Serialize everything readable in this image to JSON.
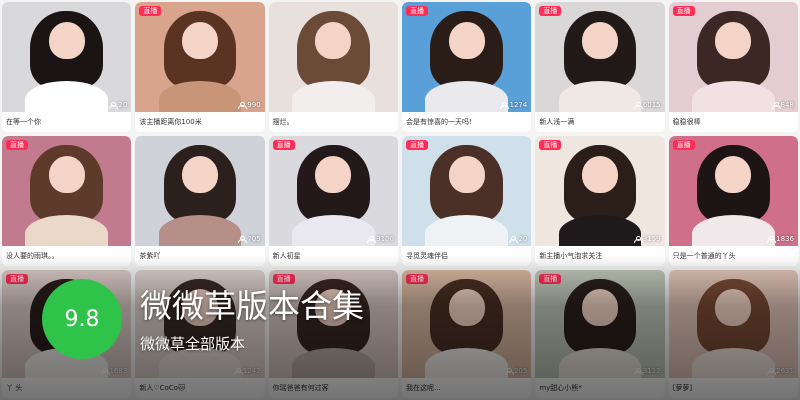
{
  "banner": {
    "score": "9.8",
    "app_name": "微微草版本合集",
    "app_subtitle": "微微草全部版本"
  },
  "live_badge": "直播",
  "streams": [
    {
      "title": "在等一个你",
      "viewers": "20",
      "live": false,
      "bg": "#d9d9dc",
      "hair": "#1b1414",
      "top": "#ffffff"
    },
    {
      "title": "该主播距离你100米",
      "viewers": "990",
      "live": true,
      "bg": "#d8a58c",
      "hair": "#5a3323",
      "top": "#c99579"
    },
    {
      "title": "摆烂。",
      "viewers": "",
      "live": false,
      "bg": "#e7e0dc",
      "hair": "#6b4a38",
      "top": "#f2eeee"
    },
    {
      "title": "会是有惊喜的一天吗!",
      "viewers": "1274",
      "live": true,
      "bg": "#5aa0d8",
      "hair": "#2a1d18",
      "top": "#e9e9ee"
    },
    {
      "title": "新人浅一满",
      "viewers": "6015",
      "live": true,
      "bg": "#d9d7d8",
      "hair": "#221a18",
      "top": "#efe8e4"
    },
    {
      "title": "稳稳很棒",
      "viewers": "848",
      "live": true,
      "bg": "#e3ccd2",
      "hair": "#3b2723",
      "top": "#f2e1e4"
    },
    {
      "title": "没人要的雨琪。。",
      "viewers": "",
      "live": true,
      "bg": "#c27b8e",
      "hair": "#5e3a2a",
      "top": "#ead8c9"
    },
    {
      "title": "茶紫吖",
      "viewers": "705",
      "live": false,
      "bg": "#cfd2d8",
      "hair": "#2c201d",
      "top": "#b58f88"
    },
    {
      "title": "新人初星",
      "viewers": "3100",
      "live": true,
      "bg": "#d9d9de",
      "hair": "#23191b",
      "top": "#e8e8ee"
    },
    {
      "title": "寻觅灵魂伴侣",
      "viewers": "20",
      "live": true,
      "bg": "#cfe0ea",
      "hair": "#4a3026",
      "top": "#eef2f4"
    },
    {
      "title": "新主播小气泡求关注",
      "viewers": "3159",
      "live": true,
      "bg": "#efe6df",
      "hair": "#2b1d18",
      "top": "#1f1a1b"
    },
    {
      "title": "只是一个普通的丫头",
      "viewers": "1836",
      "live": true,
      "bg": "#cf6f8a",
      "hair": "#1d1416",
      "top": "#f0e8ea"
    },
    {
      "title": "丫 头",
      "viewers": "1683",
      "live": true,
      "bg": "#d9c9c4",
      "hair": "#2a1e1a",
      "top": "#f2efee"
    },
    {
      "title": "新人♡CoCo🐱",
      "viewers": "1242",
      "live": false,
      "bg": "#ddd1cc",
      "hair": "#3a2a24",
      "top": "#e7dfdc"
    },
    {
      "title": "你瑶爸爸有何过客",
      "viewers": "",
      "live": true,
      "bg": "#d7c7c2",
      "hair": "#3a2721",
      "top": "#b8aba6"
    },
    {
      "title": "我在这呢...",
      "viewers": "205",
      "live": true,
      "bg": "#d9b8a2",
      "hair": "#4a3024",
      "top": "#f4f1ef"
    },
    {
      "title": "my甜心小熊*",
      "viewers": "3112",
      "live": true,
      "bg": "#bfc7b8",
      "hair": "#2a201c",
      "top": "#e9e2d8"
    },
    {
      "title": "[萝萝]",
      "viewers": "2631",
      "live": false,
      "bg": "#e2c5b8",
      "hair": "#7a4b36",
      "top": "#f1e5dd"
    }
  ]
}
